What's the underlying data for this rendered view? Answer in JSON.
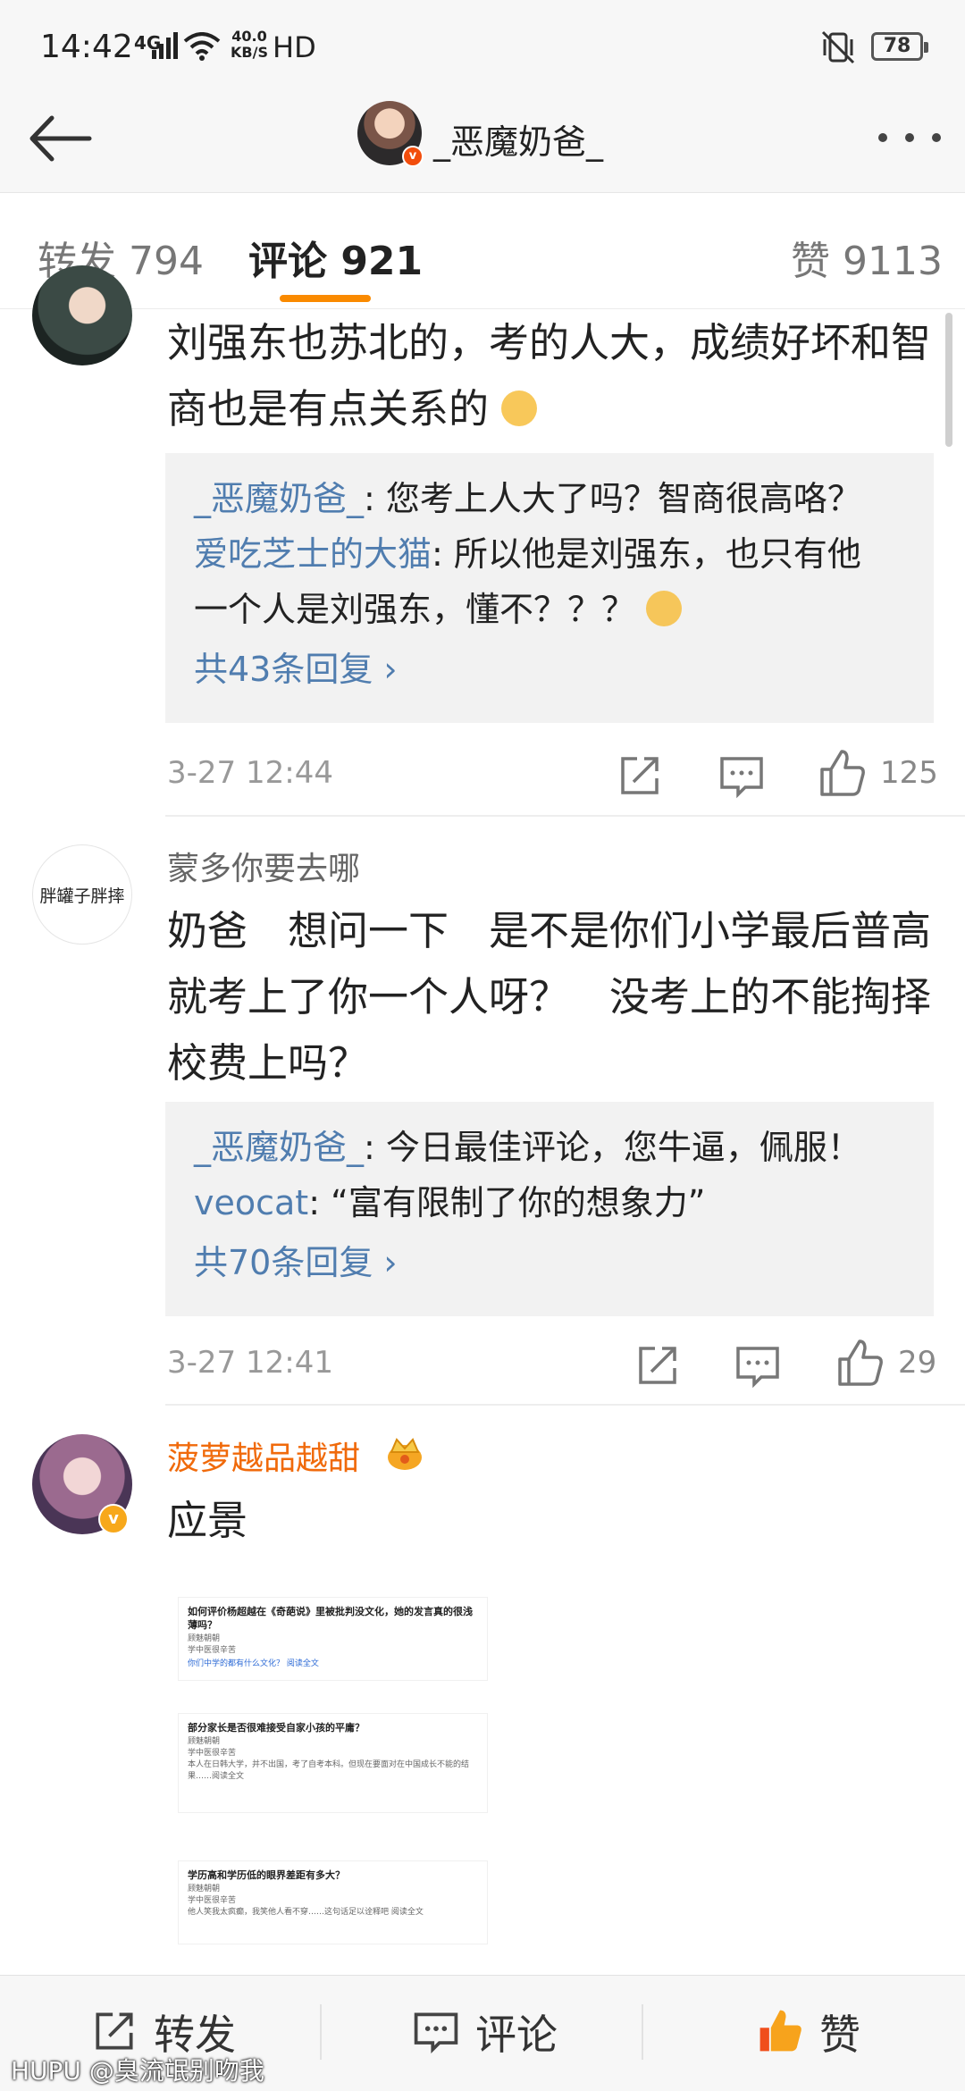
{
  "status_bar": {
    "time": "14:42",
    "network": "4G",
    "speed_value": "40.0",
    "speed_unit": "KB/S",
    "hd": "HD",
    "battery": "78"
  },
  "nav": {
    "title": "_恶魔奶爸_"
  },
  "tabs": [
    {
      "label": "转发 794"
    },
    {
      "label": "评论 921"
    },
    {
      "label": "赞 9113"
    }
  ],
  "comments": [
    {
      "author": "",
      "text_lines": [
        "刘强东也苏北的，考的人大，成绩好坏和智",
        "商也是有点关系的"
      ],
      "replies": [
        {
          "name": "_恶魔奶爸_",
          "text": ": 您考上人大了吗？智商很高咯？"
        },
        {
          "name": "爱吃芝士的大猫",
          "text": ": 所以他是刘强东，也只有他"
        },
        {
          "name": "",
          "text": "一个人是刘强东，懂不？？？"
        }
      ],
      "reply_more": "共43条回复 ›",
      "time": "3-27 12:44",
      "likes": "125"
    },
    {
      "author": "蒙多你要去哪",
      "avatar_text": "胖罐子胖摔",
      "text_lines": [
        "奶爸　想问一下　是不是你们小学最后普高",
        "就考上了你一个人呀？　没考上的不能掏择",
        "校费上吗？"
      ],
      "replies": [
        {
          "name": "_恶魔奶爸_",
          "text": ": 今日最佳评论，您牛逼，佩服！"
        },
        {
          "name": "veocat",
          "text": ": “富有限制了你的想象力”"
        }
      ],
      "reply_more": "共70条回复 ›",
      "time": "3-27 12:41",
      "likes": "29"
    },
    {
      "author": "菠萝越品越甜",
      "text_lines": [
        "应景"
      ],
      "images": [
        {
          "question": "如何评价杨超越在《奇葩说》里被批判没文化，她的发言真的很浅薄吗？",
          "author": "顾魅朝朝",
          "subtitle": "学中医很辛苦",
          "excerpt": "你们中学的都有什么文化？ 阅读全文"
        },
        {
          "question": "部分家长是否很难接受自家小孩的平庸？",
          "author": "顾魅朝朝",
          "subtitle": "学中医很辛苦",
          "excerpt": "本人在日韩大学，并不出国，考了自考本科。但现在要面对在中国成长不能的结果……阅读全文"
        },
        {
          "question": "学历高和学历低的眼界差距有多大？",
          "author": "顾魅朝朝",
          "subtitle": "学中医很辛苦",
          "excerpt": "他人笑我太疯癫，我笑他人看不穿……这句话足以诠释吧 阅读全文"
        }
      ]
    }
  ],
  "bottom_bar": {
    "repost": "转发",
    "comment": "评论",
    "like": "赞"
  },
  "watermark": "HUPU @臭流氓别吻我",
  "colors": {
    "accent": "#fa8a00",
    "link": "#507daf",
    "vip_name": "#f06a0b",
    "like_active": "#f04e1c"
  }
}
